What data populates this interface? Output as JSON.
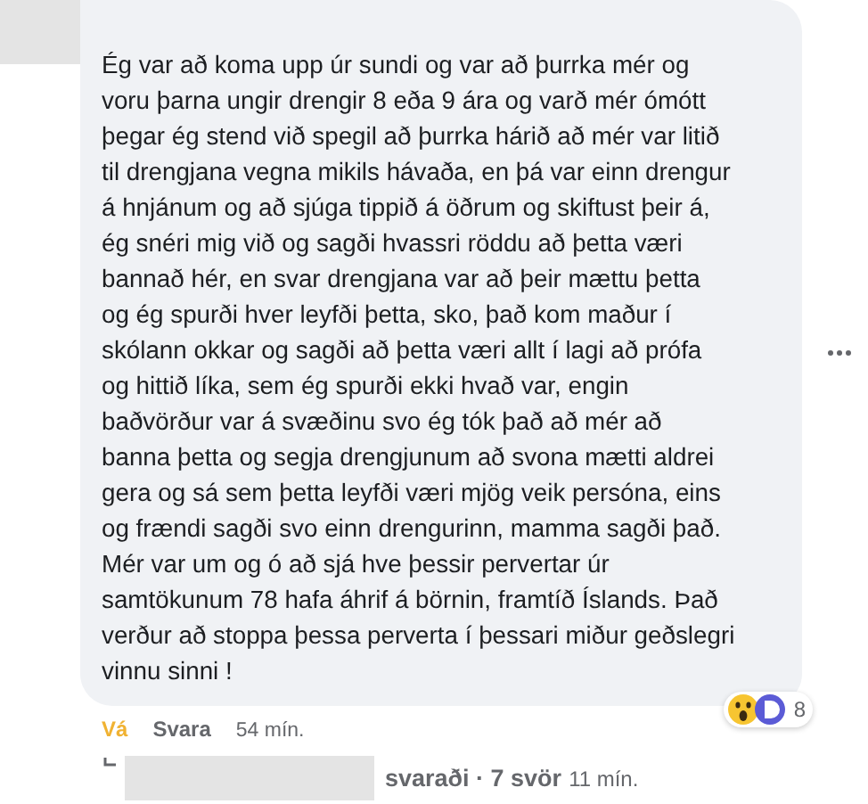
{
  "comment": {
    "text": "Ég var að koma upp úr sundi og var að þurrka mér og\nvoru þarna ungir drengir 8 eða 9 ára og varð mér ómótt\nþegar ég stend við spegil að þurrka hárið að mér var litið\ntil drengjana vegna mikils hávaða, en þá var einn drengur\ná hnjánum og að sjúga tippið á öðrum og skiftust þeir á,\nég snéri mig við og sagði hvassri röddu að þetta væri\nbannað hér, en svar drengjana var að þeir mættu þetta\nog ég spurði hver leyfði þetta, sko, það kom maður í\nskólann okkar og sagði að þetta væri allt í lagi að prófa\nog hittið líka, sem ég spurði ekki hvað var, engin\nbaðvörður var á svæðinu svo ég tók það að mér að\nbanna þetta og segja drengjunum að svona mætti aldrei\ngera og sá sem þetta leyfði væri mjög veik persóna, eins\nog frændi sagði svo einn drengurinn, mamma sagði það.\nMér var um og ó að sjá hve þessir pervertar úr\nsamtökunum 78 hafa áhrif á börnin, framtíð Íslands. Það\nverður að stoppa þessa perverta í þessari miður geðslegri\nvinnu sinni !",
    "reaction_count": "8"
  },
  "actions": [
    {
      "label": "Vá",
      "selected": true
    },
    {
      "label": "Svara",
      "selected": false
    }
  ],
  "time": "54 mín.",
  "replies": {
    "label": "svaraði · 7 svör",
    "time": "11 mín."
  }
}
